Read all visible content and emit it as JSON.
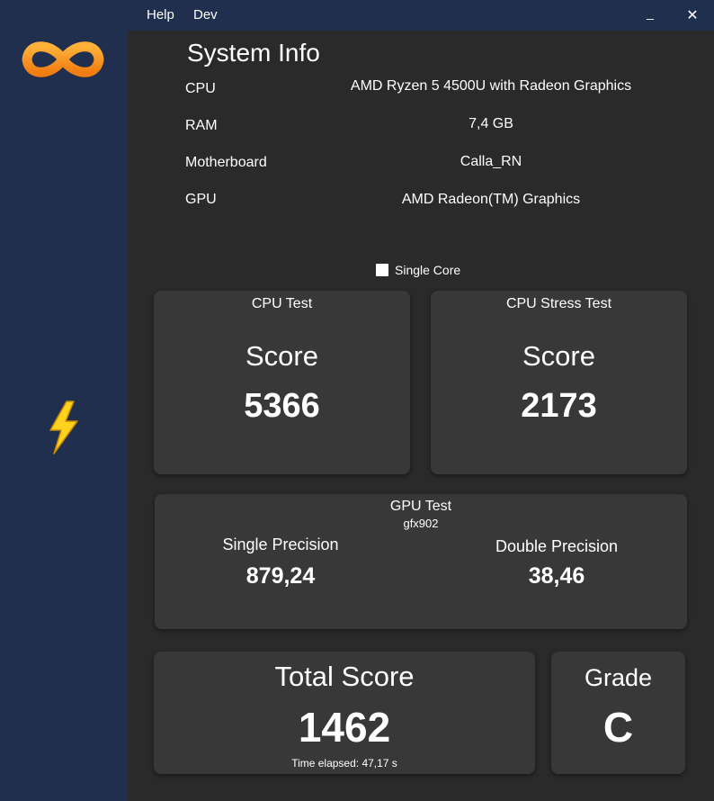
{
  "menu": {
    "help": "Help",
    "dev": "Dev"
  },
  "window": {
    "minimize": "_",
    "close": "✕"
  },
  "sidebar": {
    "logo_icon": "infinity-logo-icon",
    "bolt_icon": "lightning-bolt-icon"
  },
  "system_info": {
    "title": "System Info",
    "rows": [
      {
        "label": "CPU",
        "value": "AMD Ryzen 5 4500U with Radeon Graphics"
      },
      {
        "label": "RAM",
        "value": "7,4 GB"
      },
      {
        "label": "Motherboard",
        "value": "Calla_RN"
      },
      {
        "label": "GPU",
        "value": "AMD Radeon(TM) Graphics"
      }
    ]
  },
  "single_core": {
    "label": "Single Core",
    "checked": false
  },
  "cpu_test": {
    "title": "CPU Test",
    "score_label": "Score",
    "score": "5366"
  },
  "cpu_stress_test": {
    "title": "CPU Stress Test",
    "score_label": "Score",
    "score": "2173"
  },
  "gpu_test": {
    "title": "GPU Test",
    "device": "gfx902",
    "single_label": "Single Precision",
    "single_value": "879,24",
    "double_label": "Double Precision",
    "double_value": "38,46"
  },
  "total": {
    "label": "Total Score",
    "value": "1462",
    "elapsed": "Time elapsed: 47,17 s"
  },
  "grade": {
    "label": "Grade",
    "value": "C"
  },
  "colors": {
    "sidebar": "#1f2f4d",
    "main": "#2a2a2a",
    "card": "#383838",
    "logo_orange": "#f7941d",
    "bolt_yellow": "#ffd21f"
  }
}
